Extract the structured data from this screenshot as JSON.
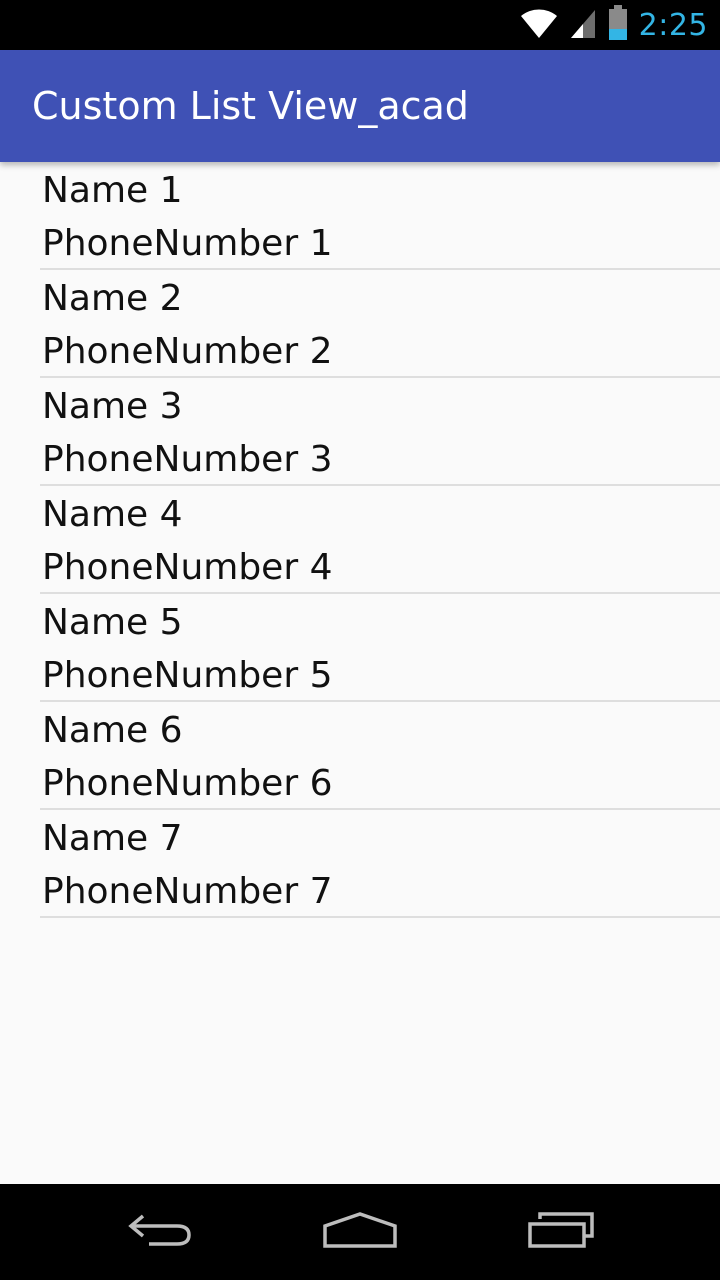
{
  "status_bar": {
    "time": "2:25",
    "icons": [
      "wifi-icon",
      "signal-icon",
      "battery-icon"
    ],
    "time_color": "#33b5e5"
  },
  "app_bar": {
    "title": "Custom List View_acad",
    "color": "#3f51b5"
  },
  "list": {
    "items": [
      {
        "name": "Name 1",
        "phone": "PhoneNumber 1"
      },
      {
        "name": "Name 2",
        "phone": "PhoneNumber 2"
      },
      {
        "name": "Name 3",
        "phone": "PhoneNumber 3"
      },
      {
        "name": "Name 4",
        "phone": "PhoneNumber 4"
      },
      {
        "name": "Name 5",
        "phone": "PhoneNumber 5"
      },
      {
        "name": "Name 6",
        "phone": "PhoneNumber 6"
      },
      {
        "name": "Name 7",
        "phone": "PhoneNumber 7"
      }
    ]
  },
  "nav_bar": {
    "buttons": [
      "back-icon",
      "home-icon",
      "recents-icon"
    ]
  }
}
